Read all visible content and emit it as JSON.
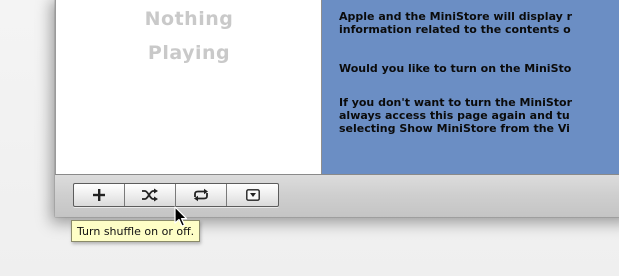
{
  "now_playing": {
    "line1": "Nothing",
    "line2": "Playing"
  },
  "ministore": {
    "paragraph1": "Apple and the MiniStore will display r\ninformation related to the contents o",
    "paragraph2": "Would you like to turn on the MiniSto",
    "paragraph3": "If you don't want to turn the MiniStor\nalways access this page again and tu\nselecting Show MiniStore from the Vi",
    "background_color": "#6b8ec4"
  },
  "toolbar": {
    "buttons": [
      {
        "icon": "plus-icon"
      },
      {
        "icon": "shuffle-icon"
      },
      {
        "icon": "repeat-icon"
      },
      {
        "icon": "show-hide-icon"
      }
    ]
  },
  "tooltip": {
    "text": "Turn shuffle on or off."
  }
}
